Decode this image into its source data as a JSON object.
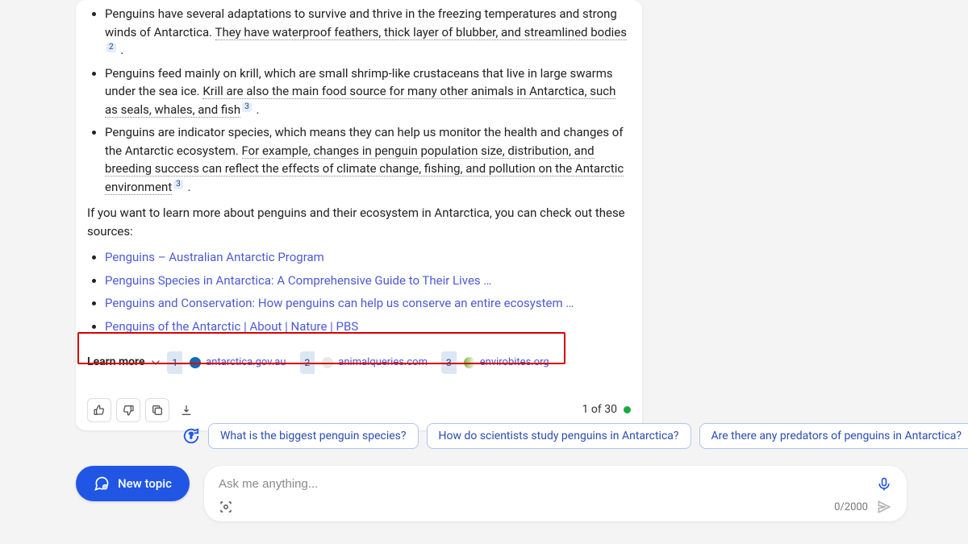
{
  "response": {
    "bullets": [
      {
        "plain": "Penguins have several adaptations to survive and thrive in the freezing temperatures and strong winds of Antarctica. ",
        "underlined": "They have waterproof feathers, thick layer of blubber, and streamlined bodies",
        "cite": "2"
      },
      {
        "plain": "Penguins feed mainly on krill, which are small shrimp-like crustaceans that live in large swarms under the sea ice. ",
        "underlined": "Krill are also the main food source for many other animals in Antarctica, such as seals, whales, and fish",
        "cite": "3"
      },
      {
        "plain": "Penguins are indicator species, which means they can help us monitor the health and changes of the Antarctic ecosystem. ",
        "underlined": "For example, changes in penguin population size, distribution, and breeding success can reflect the effects of climate change, fishing, and pollution on the Antarctic environment",
        "cite": "3"
      }
    ],
    "followup": "If you want to learn more about penguins and their ecosystem in Antarctica, you can check out these sources:",
    "links": [
      "Penguins – Australian Antarctic Program",
      "Penguins Species in Antarctica: A Comprehensive Guide to Their Lives …",
      "Penguins and Conservation: How penguins can help us conserve an entire ecosystem …",
      "Penguins of the Antarctic | About | Nature | PBS"
    ],
    "learn_more_label": "Learn more",
    "sources": [
      {
        "num": "1",
        "domain": "antarctica.gov.au",
        "favicon": "blue"
      },
      {
        "num": "2",
        "domain": "animalqueries.com",
        "favicon": "gray"
      },
      {
        "num": "3",
        "domain": "envirobites.org",
        "favicon": "green"
      }
    ],
    "counter": "1 of 30"
  },
  "suggestions": [
    "What is the biggest penguin species?",
    "How do scientists study penguins in Antarctica?",
    "Are there any predators of penguins in Antarctica?"
  ],
  "new_topic_label": "New topic",
  "input": {
    "placeholder": "Ask me anything...",
    "char_counter": "0/2000"
  }
}
